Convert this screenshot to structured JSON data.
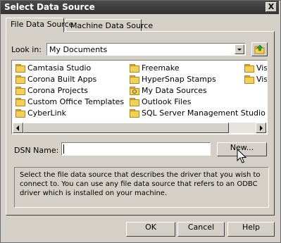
{
  "window": {
    "title": "Select Data Source",
    "close_glyph": "X"
  },
  "tabs": [
    {
      "label": "File Data Source",
      "active": true
    },
    {
      "label": "Machine Data Source",
      "active": false
    }
  ],
  "look_in": {
    "label": "Look in:",
    "value": "My Documents"
  },
  "files": {
    "col1": [
      "Camtasia Studio",
      "Corona Built Apps",
      "Corona Projects",
      "Custom Office Templates",
      "CyberLink"
    ],
    "col2": [
      "Freemake",
      "HyperSnap Stamps",
      "My Data Sources",
      "Outlook Files",
      "SQL Server Management Studio"
    ],
    "col3": [
      "Visu",
      "Visu"
    ]
  },
  "dsn": {
    "label": "DSN Name:",
    "value": "",
    "new_button": "New..."
  },
  "description": "Select the file data source that describes the driver that you wish to connect to. You can use any file data source that refers to an ODBC driver which is installed on your machine.",
  "buttons": {
    "ok": "OK",
    "cancel": "Cancel",
    "help": "Help"
  }
}
